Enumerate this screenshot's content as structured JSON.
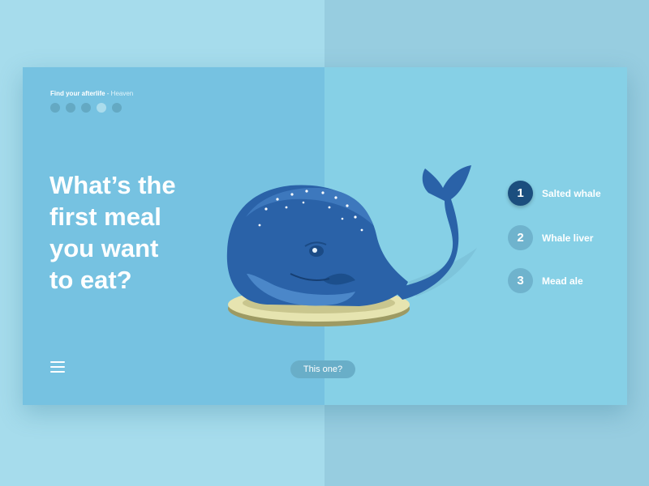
{
  "header": {
    "title": "Find your afterlife",
    "separator": " - ",
    "subtitle": "Heaven"
  },
  "progress": {
    "total_steps": 5,
    "current_step": 4
  },
  "question": {
    "line1": "What’s the",
    "line2": "first meal",
    "line3": "you want",
    "line4": "to eat?"
  },
  "options": [
    {
      "number": "1",
      "label": "Salted whale",
      "selected": true
    },
    {
      "number": "2",
      "label": "Whale liver",
      "selected": false
    },
    {
      "number": "3",
      "label": "Mead ale",
      "selected": false
    }
  ],
  "cta": {
    "label": "This one?"
  },
  "icons": {
    "menu": "hamburger-menu-icon",
    "illustration": "whale-on-plate-illustration"
  },
  "colors": {
    "background": "#a6dcec",
    "card": "#86d0e6",
    "card_left_panel": "#76c2e1",
    "accent_selected": "#1b4e7e",
    "option_badge": "#6fb3cd",
    "whale": "#2a62a8"
  }
}
